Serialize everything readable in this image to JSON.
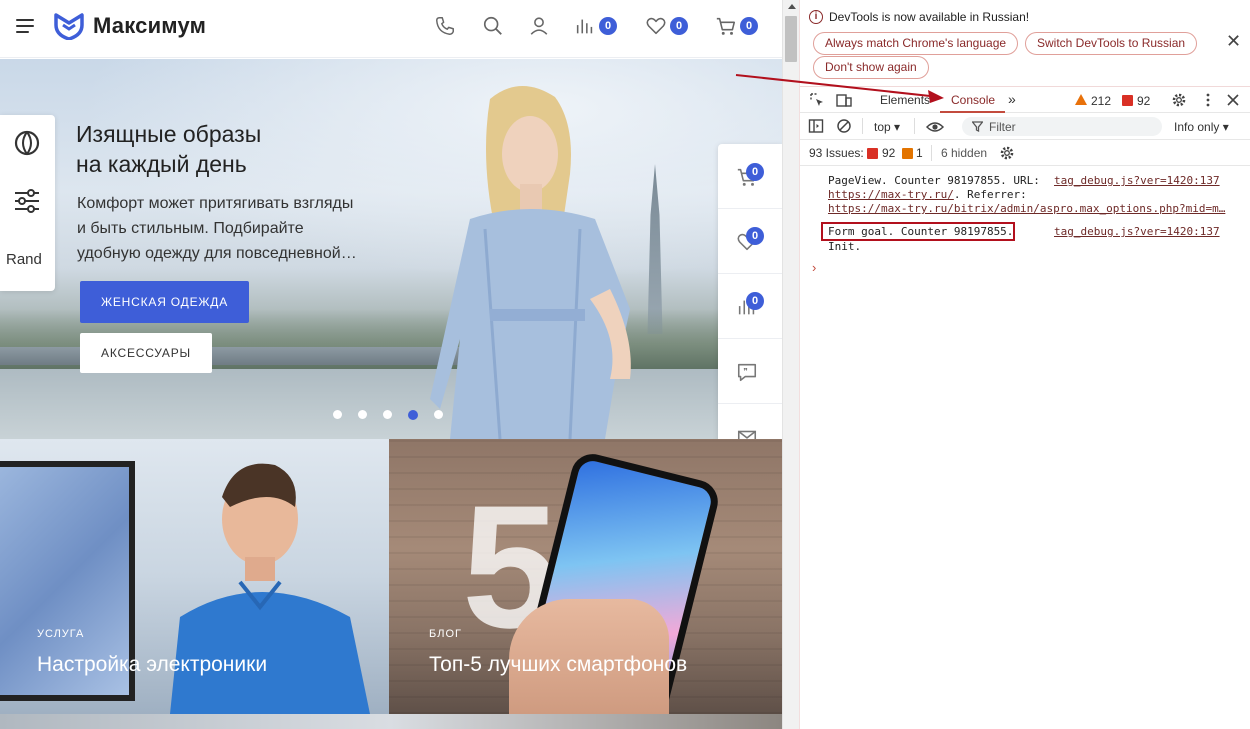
{
  "site": {
    "brand": "Максимум",
    "header": {
      "compare_count": "0",
      "favorites_count": "0",
      "cart_count": "0"
    },
    "hero": {
      "title_line1": "Изящные образы",
      "title_line2": "на каждый день",
      "text_line1": "Комфорт может притягивать взгляды",
      "text_line2": "и быть стильным. Подбирайте",
      "text_line3": "удобную одежду для повседневной…",
      "primary_button": "ЖЕНСКАЯ ОДЕЖДА",
      "secondary_button": "АКСЕССУАРЫ",
      "slides_total": 5,
      "active_slide": 4
    },
    "left_panel": {
      "label": "Rand"
    },
    "right_panel": {
      "cart_count": "0",
      "favorites_count": "0",
      "compare_count": "0"
    },
    "cards": [
      {
        "tag": "УСЛУГА",
        "title": "Настройка электроники"
      },
      {
        "tag": "БЛОГ",
        "title": "Топ-5 лучших смартфонов",
        "big_number": "5"
      }
    ]
  },
  "devtools": {
    "infobar": {
      "message": "DevTools is now available in Russian!",
      "buttons": [
        "Always match Chrome's language",
        "Switch DevTools to Russian",
        "Don't show again"
      ]
    },
    "tabs": {
      "elements": "Elements",
      "console": "Console",
      "warnings": "212",
      "errors": "92"
    },
    "toolbar": {
      "context": "top",
      "filter_placeholder": "Filter",
      "levels": "Info only"
    },
    "issues": {
      "label": "93 Issues:",
      "errors": "92",
      "info": "1",
      "hidden": "6 hidden"
    },
    "console": {
      "msg1_line1": "PageView. Counter 98197855. URL:",
      "msg1_line2": "https://max-try.ru/",
      "msg1_line2b": ". Referrer:",
      "msg1_line3": "https://max-try.ru/bitrix/admin/aspro.max_options.php?mid=m…",
      "msg1_source": "tag_debug.js?ver=1420:137",
      "msg2_line1": "Form goal. Counter 98197855.",
      "msg2_line2": "Init.",
      "msg2_source": "tag_debug.js?ver=1420:137"
    }
  },
  "colors": {
    "accent": "#3e5ed8",
    "devtools_accent": "#8a2a2a",
    "highlight_box": "#b2101d",
    "annotation_arrow": "#b2101d"
  }
}
